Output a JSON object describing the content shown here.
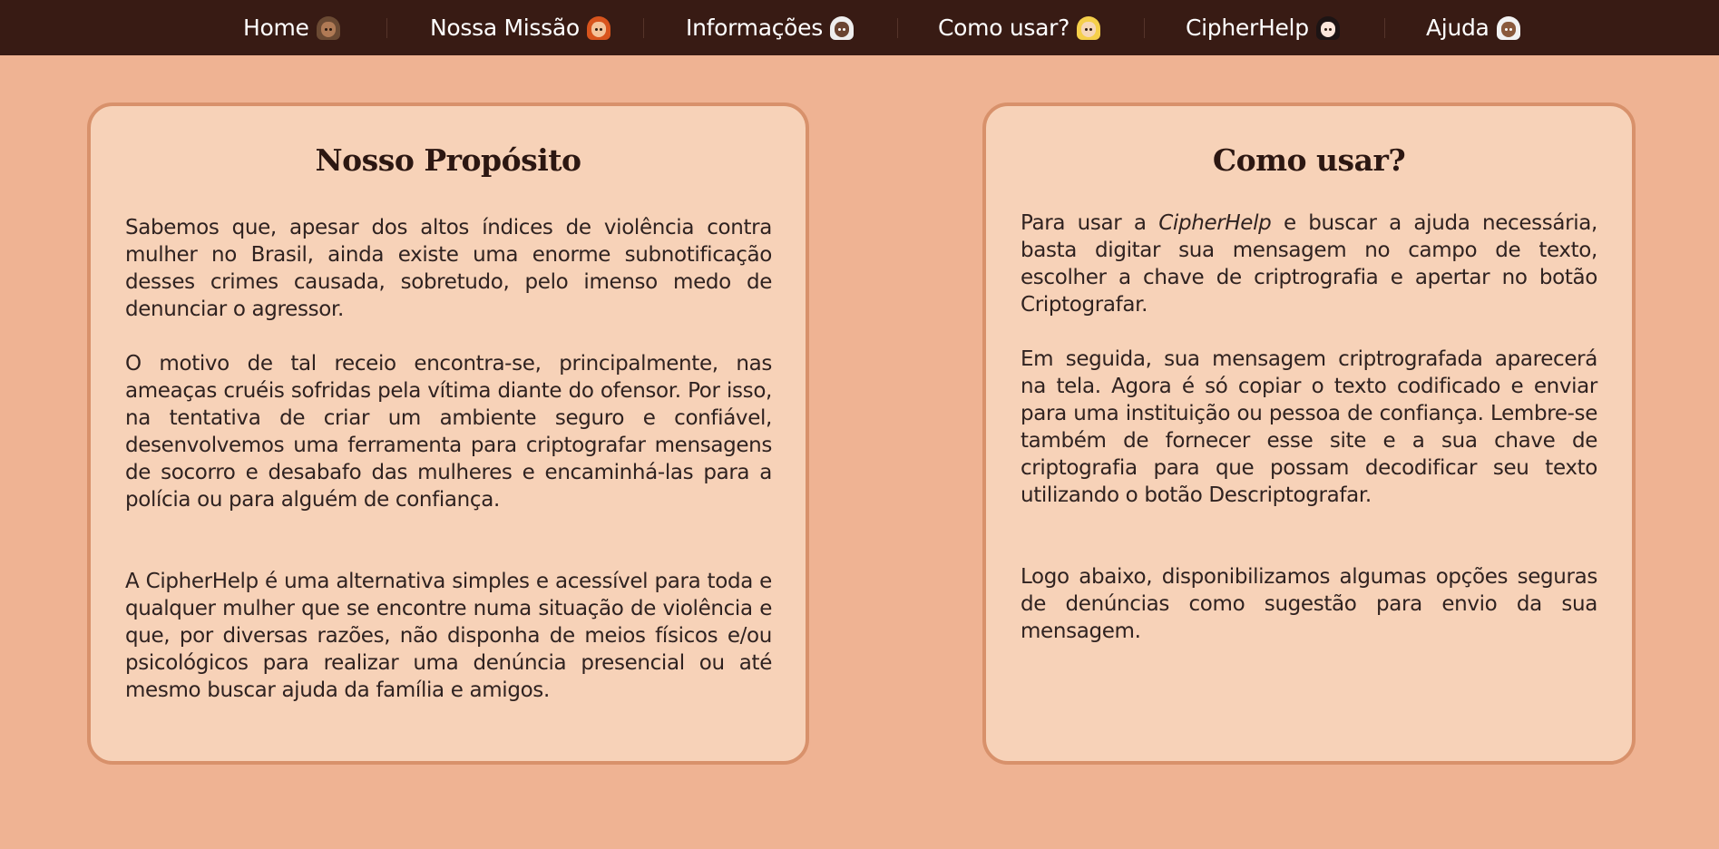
{
  "nav": {
    "items": [
      {
        "label": "Home",
        "avatar": "woman-medium-skin-icon"
      },
      {
        "label": "Nossa Missão",
        "avatar": "woman-red-hair-icon"
      },
      {
        "label": "Informações",
        "avatar": "woman-dark-hair-icon"
      },
      {
        "label": "Como usar?",
        "avatar": "woman-blonde-icon"
      },
      {
        "label": "CipherHelp",
        "avatar": "woman-black-hair-icon"
      },
      {
        "label": "Ajuda",
        "avatar": "woman-headscarf-icon"
      }
    ]
  },
  "colors": {
    "navbar": "#381b14",
    "background": "#efb393",
    "card": "#f7d2b8",
    "card_border": "#d8916b",
    "text": "#2f2220"
  },
  "proposito": {
    "title": "Nosso Propósito",
    "p1": "Sabemos que, apesar dos altos índices de violência contra mulher no Brasil, ainda existe uma enorme subnotificação desses crimes causada, sobretudo, pelo imenso medo de denunciar o agressor.",
    "p2": "O motivo de tal receio encontra-se, principalmente, nas ameaças cruéis sofridas pela vítima diante do ofensor. Por isso, na tentativa de criar um ambiente seguro e confiável, desenvolvemos uma ferramenta para criptografar mensagens de socorro e desabafo das mulheres e encaminhá-las para a polícia ou para alguém de confiança.",
    "p3": "A CipherHelp é uma alternativa simples e acessível para toda e qualquer mulher que se encontre numa situação de violência e que, por diversas razões, não disponha de meios físicos e/ou psicológicos para realizar uma denúncia presencial ou até mesmo buscar ajuda da família e amigos."
  },
  "como_usar": {
    "title": "Como usar?",
    "p1_prefix": "Para usar a ",
    "p1_brand": "CipherHelp",
    "p1_suffix": " e buscar a ajuda necessária, basta digitar sua mensagem no campo de texto, escolher a chave de criptrografia e apertar no botão Criptografar.",
    "p2": "Em seguida, sua mensagem criptrografada aparecerá na tela. Agora é só copiar o texto codificado e enviar para uma instituição ou pessoa de confiança. Lembre-se também de fornecer esse site e a sua chave de criptografia para que possam decodificar seu texto utilizando o botão Descriptografar.",
    "p3": "Logo abaixo, disponibilizamos algumas opções seguras de denúncias como sugestão para envio da sua mensagem."
  }
}
